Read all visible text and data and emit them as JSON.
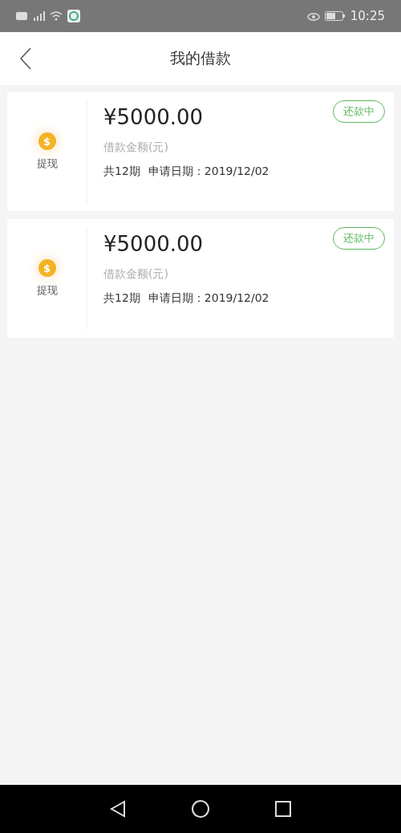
{
  "status_bar": {
    "time": "10:25"
  },
  "header": {
    "title": "我的借款"
  },
  "loans": [
    {
      "coin_symbol": "$",
      "type_label": "提现",
      "amount": "¥5000.00",
      "amount_label": "借款金额(元)",
      "terms": "共12期",
      "date_label": "申请日期：2019/12/02",
      "status": "还款中"
    },
    {
      "coin_symbol": "$",
      "type_label": "提现",
      "amount": "¥5000.00",
      "amount_label": "借款金额(元)",
      "terms": "共12期",
      "date_label": "申请日期：2019/12/02",
      "status": "还款中"
    }
  ]
}
